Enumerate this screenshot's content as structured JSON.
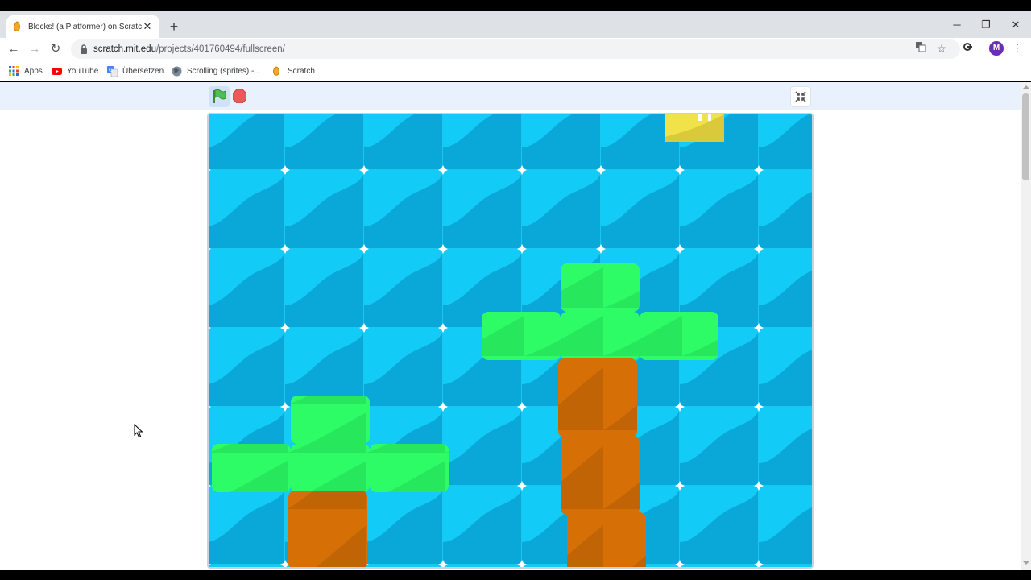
{
  "browser": {
    "tab": {
      "title": "Blocks! (a Platformer) on Scratch",
      "close": "✕"
    },
    "new_tab": "+",
    "window_controls": {
      "minimize": "─",
      "restore": "❐",
      "close": "✕"
    },
    "nav": {
      "back": "←",
      "forward": "→",
      "reload": "↻"
    },
    "address": {
      "domain": "scratch.mit.edu",
      "path": "/projects/401760494/fullscreen/"
    },
    "profile_initial": "M",
    "bookmarks": [
      {
        "label": "Apps",
        "icon": "apps-grid-icon"
      },
      {
        "label": "YouTube",
        "icon": "youtube-icon"
      },
      {
        "label": "Übersetzen",
        "icon": "translate-icon"
      },
      {
        "label": "Scrolling (sprites) -...",
        "icon": "scratch-globe-icon"
      },
      {
        "label": "Scratch",
        "icon": "scratch-cat-icon"
      }
    ]
  },
  "player": {
    "controls": [
      "green-flag-icon",
      "stop-icon",
      "exit-fullscreen-icon"
    ]
  },
  "colors": {
    "sky_light": "#12cbf6",
    "sky_dark": "#0aa8d8",
    "grass": "#2dfc66",
    "dirt": "#d67006",
    "player": "#f2e24a"
  }
}
